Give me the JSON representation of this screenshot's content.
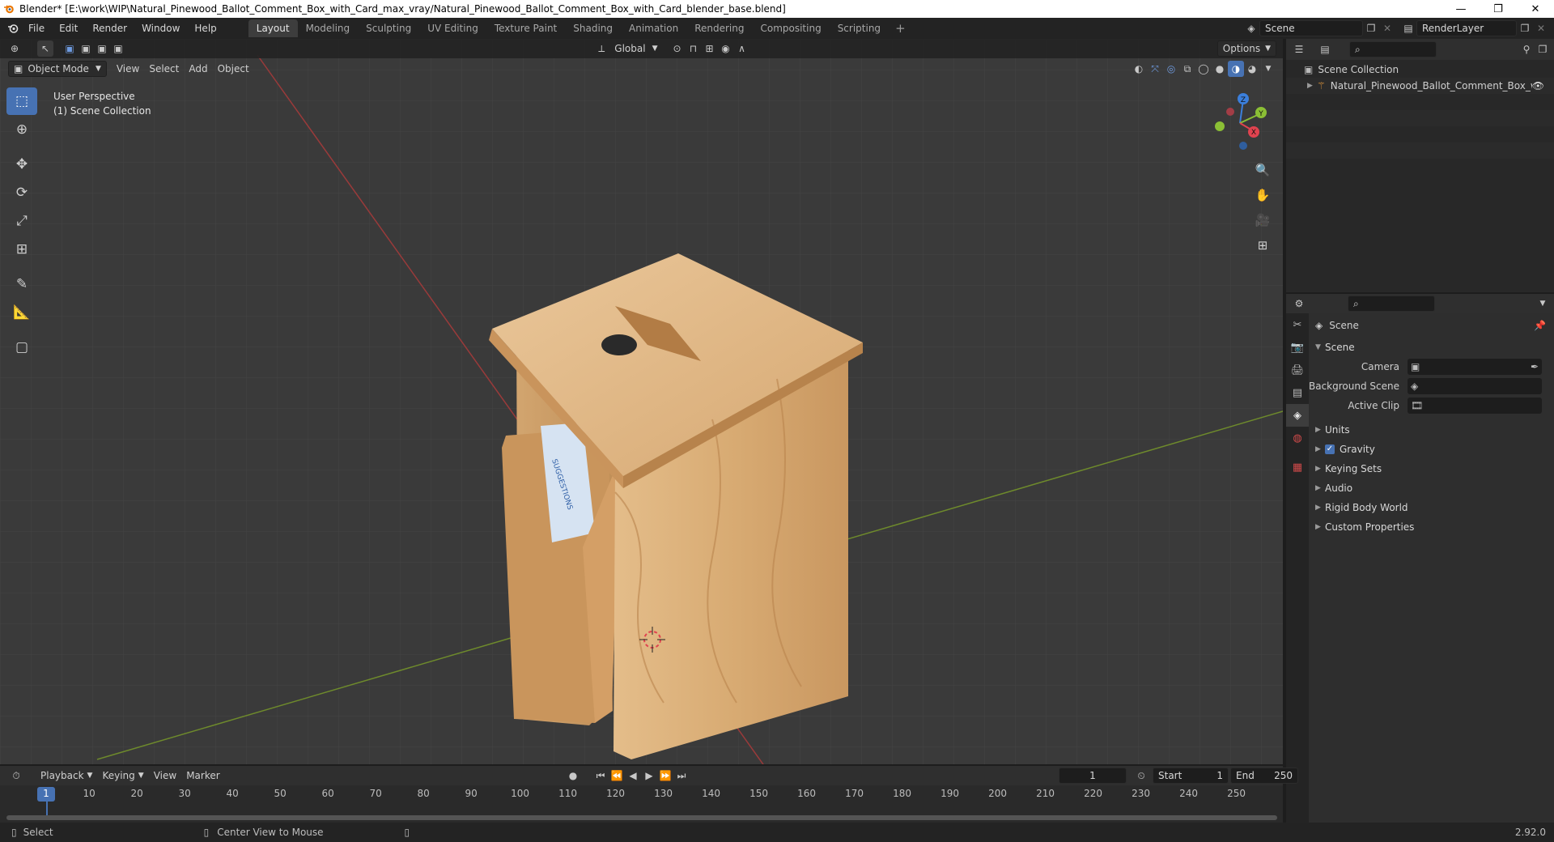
{
  "window": {
    "title": "Blender* [E:\\work\\WIP\\Natural_Pinewood_Ballot_Comment_Box_with_Card_max_vray/Natural_Pinewood_Ballot_Comment_Box_with_Card_blender_base.blend]",
    "minimize": "—",
    "maximize": "❐",
    "close": "✕"
  },
  "menu": {
    "items": [
      "File",
      "Edit",
      "Render",
      "Window",
      "Help"
    ],
    "workspaces": [
      "Layout",
      "Modeling",
      "Sculpting",
      "UV Editing",
      "Texture Paint",
      "Shading",
      "Animation",
      "Rendering",
      "Compositing",
      "Scripting"
    ],
    "active_workspace": "Layout",
    "add_tab": "+",
    "scene": "Scene",
    "view_layer": "RenderLayer"
  },
  "viewport": {
    "mode": "Object Mode",
    "menus": [
      "View",
      "Select",
      "Add",
      "Object"
    ],
    "orientation": "Global",
    "options": "Options",
    "info_line1": "User Perspective",
    "info_line2": "(1) Scene Collection",
    "axes": {
      "x": "X",
      "y": "Y",
      "z": "Z"
    },
    "card_text": "SUGGESTIONS"
  },
  "outliner": {
    "root": "Scene Collection",
    "object": "Natural_Pinewood_Ballot_Comment_Box_wi"
  },
  "properties": {
    "context": "Scene",
    "panel": "Scene",
    "camera_label": "Camera",
    "background_scene_label": "Background Scene",
    "active_clip_label": "Active Clip",
    "panels": [
      "Units",
      "Gravity",
      "Keying Sets",
      "Audio",
      "Rigid Body World",
      "Custom Properties"
    ],
    "gravity_checked": true
  },
  "timeline": {
    "menus": [
      "Playback",
      "Keying",
      "View",
      "Marker"
    ],
    "current_frame": "1",
    "start_label": "Start",
    "start": "1",
    "end_label": "End",
    "end": "250",
    "ruler": [
      "1",
      "10",
      "20",
      "30",
      "40",
      "50",
      "60",
      "70",
      "80",
      "90",
      "100",
      "110",
      "120",
      "130",
      "140",
      "150",
      "160",
      "170",
      "180",
      "190",
      "200",
      "210",
      "220",
      "230",
      "240",
      "250"
    ]
  },
  "status": {
    "select": "Select",
    "center_view": "Center View to Mouse",
    "version": "2.92.0"
  },
  "colors": {
    "accent": "#4772b3",
    "axis_x": "#e0434f",
    "axis_y": "#8bbf35",
    "axis_z": "#3b7fdc",
    "wood_light": "#ddb37f",
    "wood_dark": "#b9834c"
  }
}
